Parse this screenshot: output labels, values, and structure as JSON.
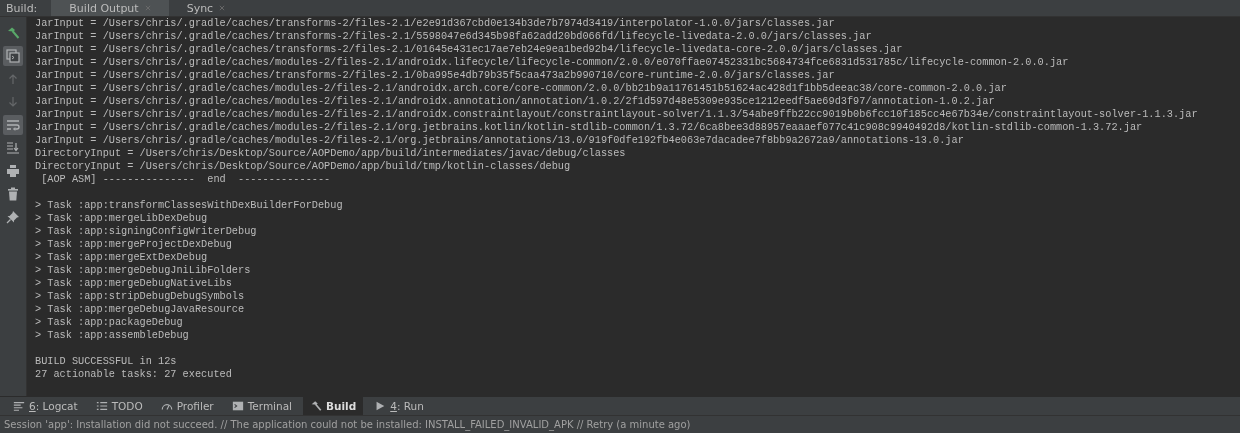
{
  "header": {
    "label": "Build:",
    "tabs": [
      {
        "label": "Build Output",
        "selected": true,
        "closable": true
      },
      {
        "label": "Sync",
        "selected": false,
        "closable": true
      }
    ]
  },
  "sidebar": {
    "buttons": [
      {
        "kind": "hammer",
        "on": false,
        "disabled": false
      },
      {
        "kind": "console",
        "on": true,
        "disabled": false
      },
      {
        "kind": "up",
        "on": false,
        "disabled": true
      },
      {
        "kind": "down",
        "on": false,
        "disabled": true
      },
      {
        "kind": "wrap",
        "on": true,
        "disabled": false
      },
      {
        "kind": "scroll-end",
        "on": false,
        "disabled": false
      },
      {
        "kind": "print",
        "on": false,
        "disabled": false
      },
      {
        "kind": "trash",
        "on": false,
        "disabled": false
      },
      {
        "kind": "pin",
        "on": false,
        "disabled": false
      }
    ]
  },
  "console": {
    "blocks": [
      {
        "lines": [
          "JarInput = /Users/chris/.gradle/caches/transforms-2/files-2.1/e2e91d367cbd0e134b3de7b7974d3419/interpolator-1.0.0/jars/classes.jar",
          "JarInput = /Users/chris/.gradle/caches/transforms-2/files-2.1/5598047e6d345b98fa62add20bd066fd/lifecycle-livedata-2.0.0/jars/classes.jar",
          "JarInput = /Users/chris/.gradle/caches/transforms-2/files-2.1/01645e431ec17ae7eb24e9ea1bed92b4/lifecycle-livedata-core-2.0.0/jars/classes.jar",
          "JarInput = /Users/chris/.gradle/caches/modules-2/files-2.1/androidx.lifecycle/lifecycle-common/2.0.0/e070ffae07452331bc5684734fce6831d531785c/lifecycle-common-2.0.0.jar",
          "JarInput = /Users/chris/.gradle/caches/transforms-2/files-2.1/0ba995e4db79b35f5caa473a2b990710/core-runtime-2.0.0/jars/classes.jar",
          "JarInput = /Users/chris/.gradle/caches/modules-2/files-2.1/androidx.arch.core/core-common/2.0.0/bb21b9a11761451b51624ac428d1f1bb5deeac38/core-common-2.0.0.jar",
          "JarInput = /Users/chris/.gradle/caches/modules-2/files-2.1/androidx.annotation/annotation/1.0.2/2f1d597d48e5309e935ce1212eedf5ae69d3f97/annotation-1.0.2.jar",
          "JarInput = /Users/chris/.gradle/caches/modules-2/files-2.1/androidx.constraintlayout/constraintlayout-solver/1.1.3/54abe9ffb22cc9019b0b6fcc10f185cc4e67b34e/constraintlayout-solver-1.1.3.jar",
          "JarInput = /Users/chris/.gradle/caches/modules-2/files-2.1/org.jetbrains.kotlin/kotlin-stdlib-common/1.3.72/6ca8bee3d88957eaaaef077c41c908c9940492d8/kotlin-stdlib-common-1.3.72.jar",
          "JarInput = /Users/chris/.gradle/caches/modules-2/files-2.1/org.jetbrains/annotations/13.0/919f0dfe192fb4e063e7dacadee7f8bb9a2672a9/annotations-13.0.jar",
          "DirectoryInput = /Users/chris/Desktop/Source/AOPDemo/app/build/intermediates/javac/debug/classes",
          "DirectoryInput = /Users/chris/Desktop/Source/AOPDemo/app/build/tmp/kotlin-classes/debug",
          " [AOP ASM] ---------------  end  ---------------"
        ]
      },
      {
        "lines": [
          "> Task :app:transformClassesWithDexBuilderForDebug",
          "> Task :app:mergeLibDexDebug",
          "> Task :app:signingConfigWriterDebug",
          "> Task :app:mergeProjectDexDebug",
          "> Task :app:mergeExtDexDebug",
          "> Task :app:mergeDebugJniLibFolders",
          "> Task :app:mergeDebugNativeLibs",
          "> Task :app:stripDebugDebugSymbols",
          "> Task :app:mergeDebugJavaResource",
          "> Task :app:packageDebug",
          "> Task :app:assembleDebug"
        ]
      },
      {
        "lines": [
          "BUILD SUCCESSFUL in 12s",
          "27 actionable tasks: 27 executed"
        ]
      }
    ]
  },
  "tool_windows": [
    {
      "kind": "logcat",
      "label": "6: Logcat",
      "mnemonic": true,
      "selected": false
    },
    {
      "kind": "todo",
      "label": "TODO",
      "mnemonic": false,
      "selected": false
    },
    {
      "kind": "profiler",
      "label": "Profiler",
      "mnemonic": false,
      "selected": false
    },
    {
      "kind": "terminal",
      "label": "Terminal",
      "mnemonic": false,
      "selected": false
    },
    {
      "kind": "build",
      "label": "Build",
      "mnemonic": false,
      "selected": true
    },
    {
      "kind": "run",
      "label": "4: Run",
      "mnemonic": true,
      "selected": false
    }
  ],
  "status_bar": "Session 'app': Installation did not succeed. // The application could not be installed: INSTALL_FAILED_INVALID_APK // Retry (a minute ago)"
}
